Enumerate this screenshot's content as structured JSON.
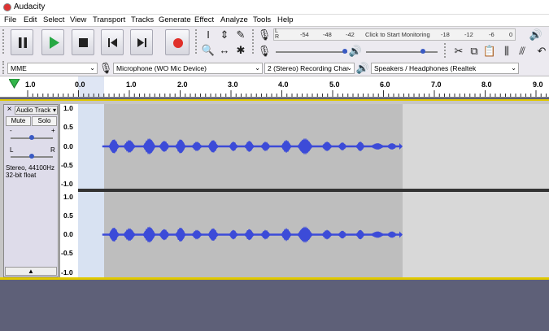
{
  "window": {
    "title": "Audacity"
  },
  "menu": [
    "File",
    "Edit",
    "Select",
    "View",
    "Transport",
    "Tracks",
    "Generate",
    "Effect",
    "Analyze",
    "Tools",
    "Help"
  ],
  "meter": {
    "rec_scale": [
      "L",
      "R"
    ],
    "rec_ticks": [
      "-54",
      "-48",
      "-42",
      "-18",
      "-12",
      "-6",
      "0"
    ],
    "monitor_hint": "Click to Start Monitoring"
  },
  "device": {
    "host": "MME",
    "input": "Microphone (WO Mic Device)",
    "channels": "2 (Stereo) Recording Char",
    "output": "Speakers / Headphones (Realtek"
  },
  "ruler": {
    "ticks": [
      "1.0",
      "0.0",
      "1.0",
      "2.0",
      "3.0",
      "4.0",
      "5.0",
      "6.0",
      "7.0",
      "8.0",
      "9.0"
    ]
  },
  "track": {
    "name": "Audio Track",
    "mute": "Mute",
    "solo": "Solo",
    "gain_minus": "-",
    "gain_plus": "+",
    "pan_left": "L",
    "pan_right": "R",
    "info_line1": "Stereo, 44100Hz",
    "info_line2": "32-bit float",
    "scale": [
      "1.0",
      "0.5",
      "0.0",
      "-0.5",
      "-1.0"
    ]
  },
  "colors": {
    "waveform": "#3c4bd8",
    "selection": "#d8e2f2",
    "accent": "#e0c800"
  }
}
